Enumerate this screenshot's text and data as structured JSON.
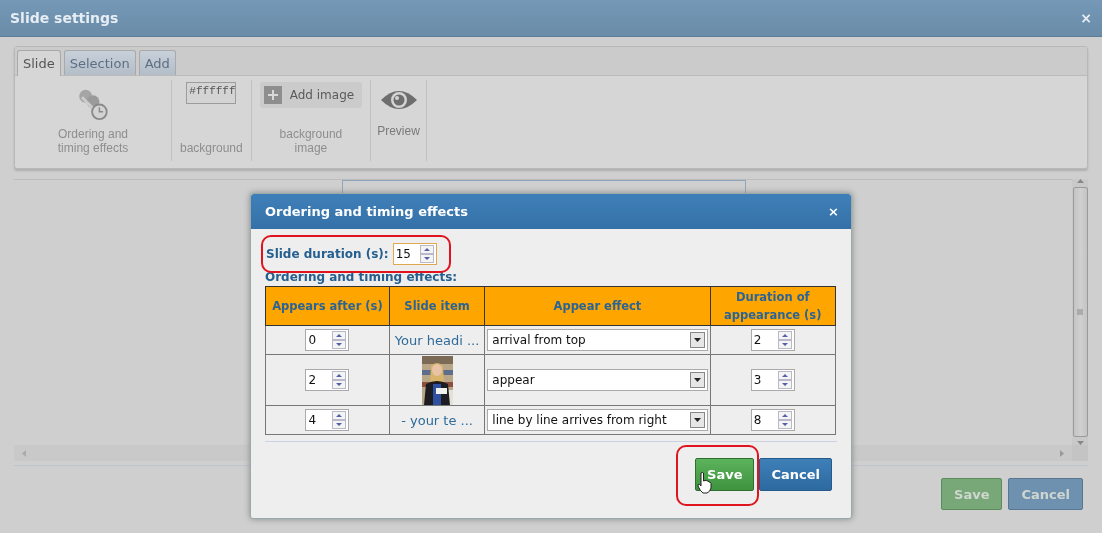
{
  "window": {
    "title": "Slide settings",
    "close": "×"
  },
  "tabs": [
    {
      "label": "Slide",
      "selected": true
    },
    {
      "label": "Selection",
      "selected": false
    },
    {
      "label": "Add",
      "selected": false
    }
  ],
  "toolbar": {
    "ordering": {
      "label": "Ordering and timing effects"
    },
    "background": {
      "value": "#ffffff",
      "label": "background"
    },
    "background_image": {
      "button": "Add image",
      "label": "background image"
    },
    "preview": {
      "label": "Preview"
    }
  },
  "buttons": [
    "Save",
    "Cancel"
  ],
  "dialog": {
    "title": "Ordering and timing effects",
    "close": "×",
    "duration": {
      "label": "Slide duration (s):",
      "value": "15",
      "highlighted": true
    },
    "subtitle": "Ordering and timing effects:",
    "columns": [
      "Appears after (s)",
      "Slide item",
      "Appear effect",
      "Duration of appearance (s)"
    ],
    "rows": [
      {
        "appears_after": "0",
        "item": {
          "kind": "text",
          "text": "Your headi ..."
        },
        "effect": "arrival from top",
        "duration": "2"
      },
      {
        "appears_after": "2",
        "effect": "appear",
        "duration": "3"
      },
      {
        "appears_after": "4",
        "item": {
          "kind": "text",
          "text": "- your te ..."
        },
        "effect": "line by line arrives from right",
        "duration": "8"
      }
    ],
    "buttons": [
      {
        "label": "Save",
        "kind": "primary",
        "highlighted": true
      },
      {
        "label": "Cancel",
        "kind": "secondary",
        "highlighted": false
      }
    ]
  }
}
